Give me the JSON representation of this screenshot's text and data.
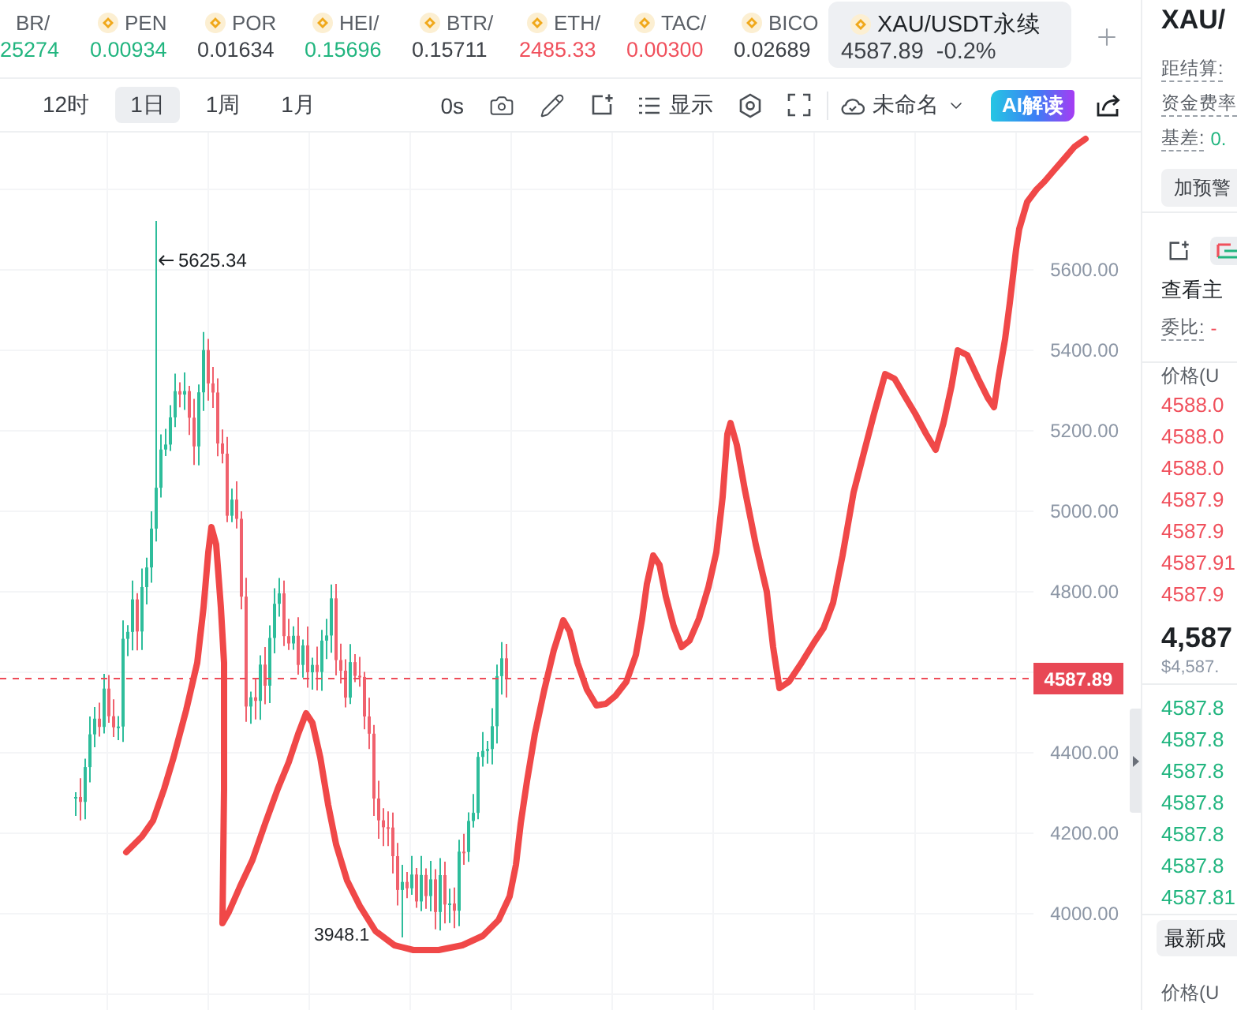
{
  "tickers": [
    {
      "name": "BR/",
      "price": "25274",
      "color": "#21b57f",
      "icon": false,
      "selected": false
    },
    {
      "name": "PEN",
      "price": "0.00934",
      "color": "#21b57f",
      "icon": true,
      "selected": false
    },
    {
      "name": "POR",
      "price": "0.01634",
      "color": "#3d4147",
      "icon": true,
      "selected": false
    },
    {
      "name": "HEI/",
      "price": "0.15696",
      "color": "#21b57f",
      "icon": true,
      "selected": false
    },
    {
      "name": "BTR/",
      "price": "0.15711",
      "color": "#3d4147",
      "icon": true,
      "selected": false
    },
    {
      "name": "ETH/",
      "price": "2485.33",
      "color": "#f0505c",
      "icon": true,
      "selected": false
    },
    {
      "name": "TAC/",
      "price": "0.00300",
      "color": "#f0505c",
      "icon": true,
      "selected": false
    },
    {
      "name": "BICO",
      "price": "0.02689",
      "color": "#3d4147",
      "icon": true,
      "selected": false
    },
    {
      "name": "XAU/USDT永续",
      "price": "4587.89",
      "change": "-0.2%",
      "color": "#3d4147",
      "icon": true,
      "selected": true
    }
  ],
  "toolbar": {
    "intervals": [
      {
        "label": "12时",
        "selected": false
      },
      {
        "label": "1日",
        "selected": true
      },
      {
        "label": "1周",
        "selected": false
      },
      {
        "label": "1月",
        "selected": false
      }
    ],
    "countdown": "0s",
    "display_label": "显示",
    "layout_name": "未命名",
    "ai_button": "AI解读"
  },
  "chart": {
    "price_axis": [
      "5600.00",
      "5400.00",
      "5200.00",
      "5000.00",
      "4800.00",
      "4400.00",
      "4200.00",
      "4000.00"
    ],
    "current_price": "4587.89",
    "high_label": "5625.34",
    "low_label": "3948.1"
  },
  "side_panel": {
    "title": "XAU/",
    "settlement_label": "距结算:",
    "funding_label": "资金费率",
    "basis_label": "基差:",
    "basis_value": "0.",
    "alert_button": "加预警",
    "views": [
      {
        "selected": false
      },
      {
        "selected": true
      }
    ],
    "main_force_label": "查看主",
    "ratio_label": "委比:",
    "ratio_value": "-",
    "price_header": "价格(U",
    "asks": [
      "4588.0",
      "4588.0",
      "4588.0",
      "4587.9",
      "4587.9",
      "4587.91",
      "4587.9"
    ],
    "last_price": "4,587",
    "last_price_usd": "$4,587.",
    "bids": [
      "4587.8",
      "4587.8",
      "4587.8",
      "4587.8",
      "4587.8",
      "4587.8",
      "4587.81"
    ],
    "trades_tab": "最新成",
    "trades_price_header": "价格(U"
  }
}
